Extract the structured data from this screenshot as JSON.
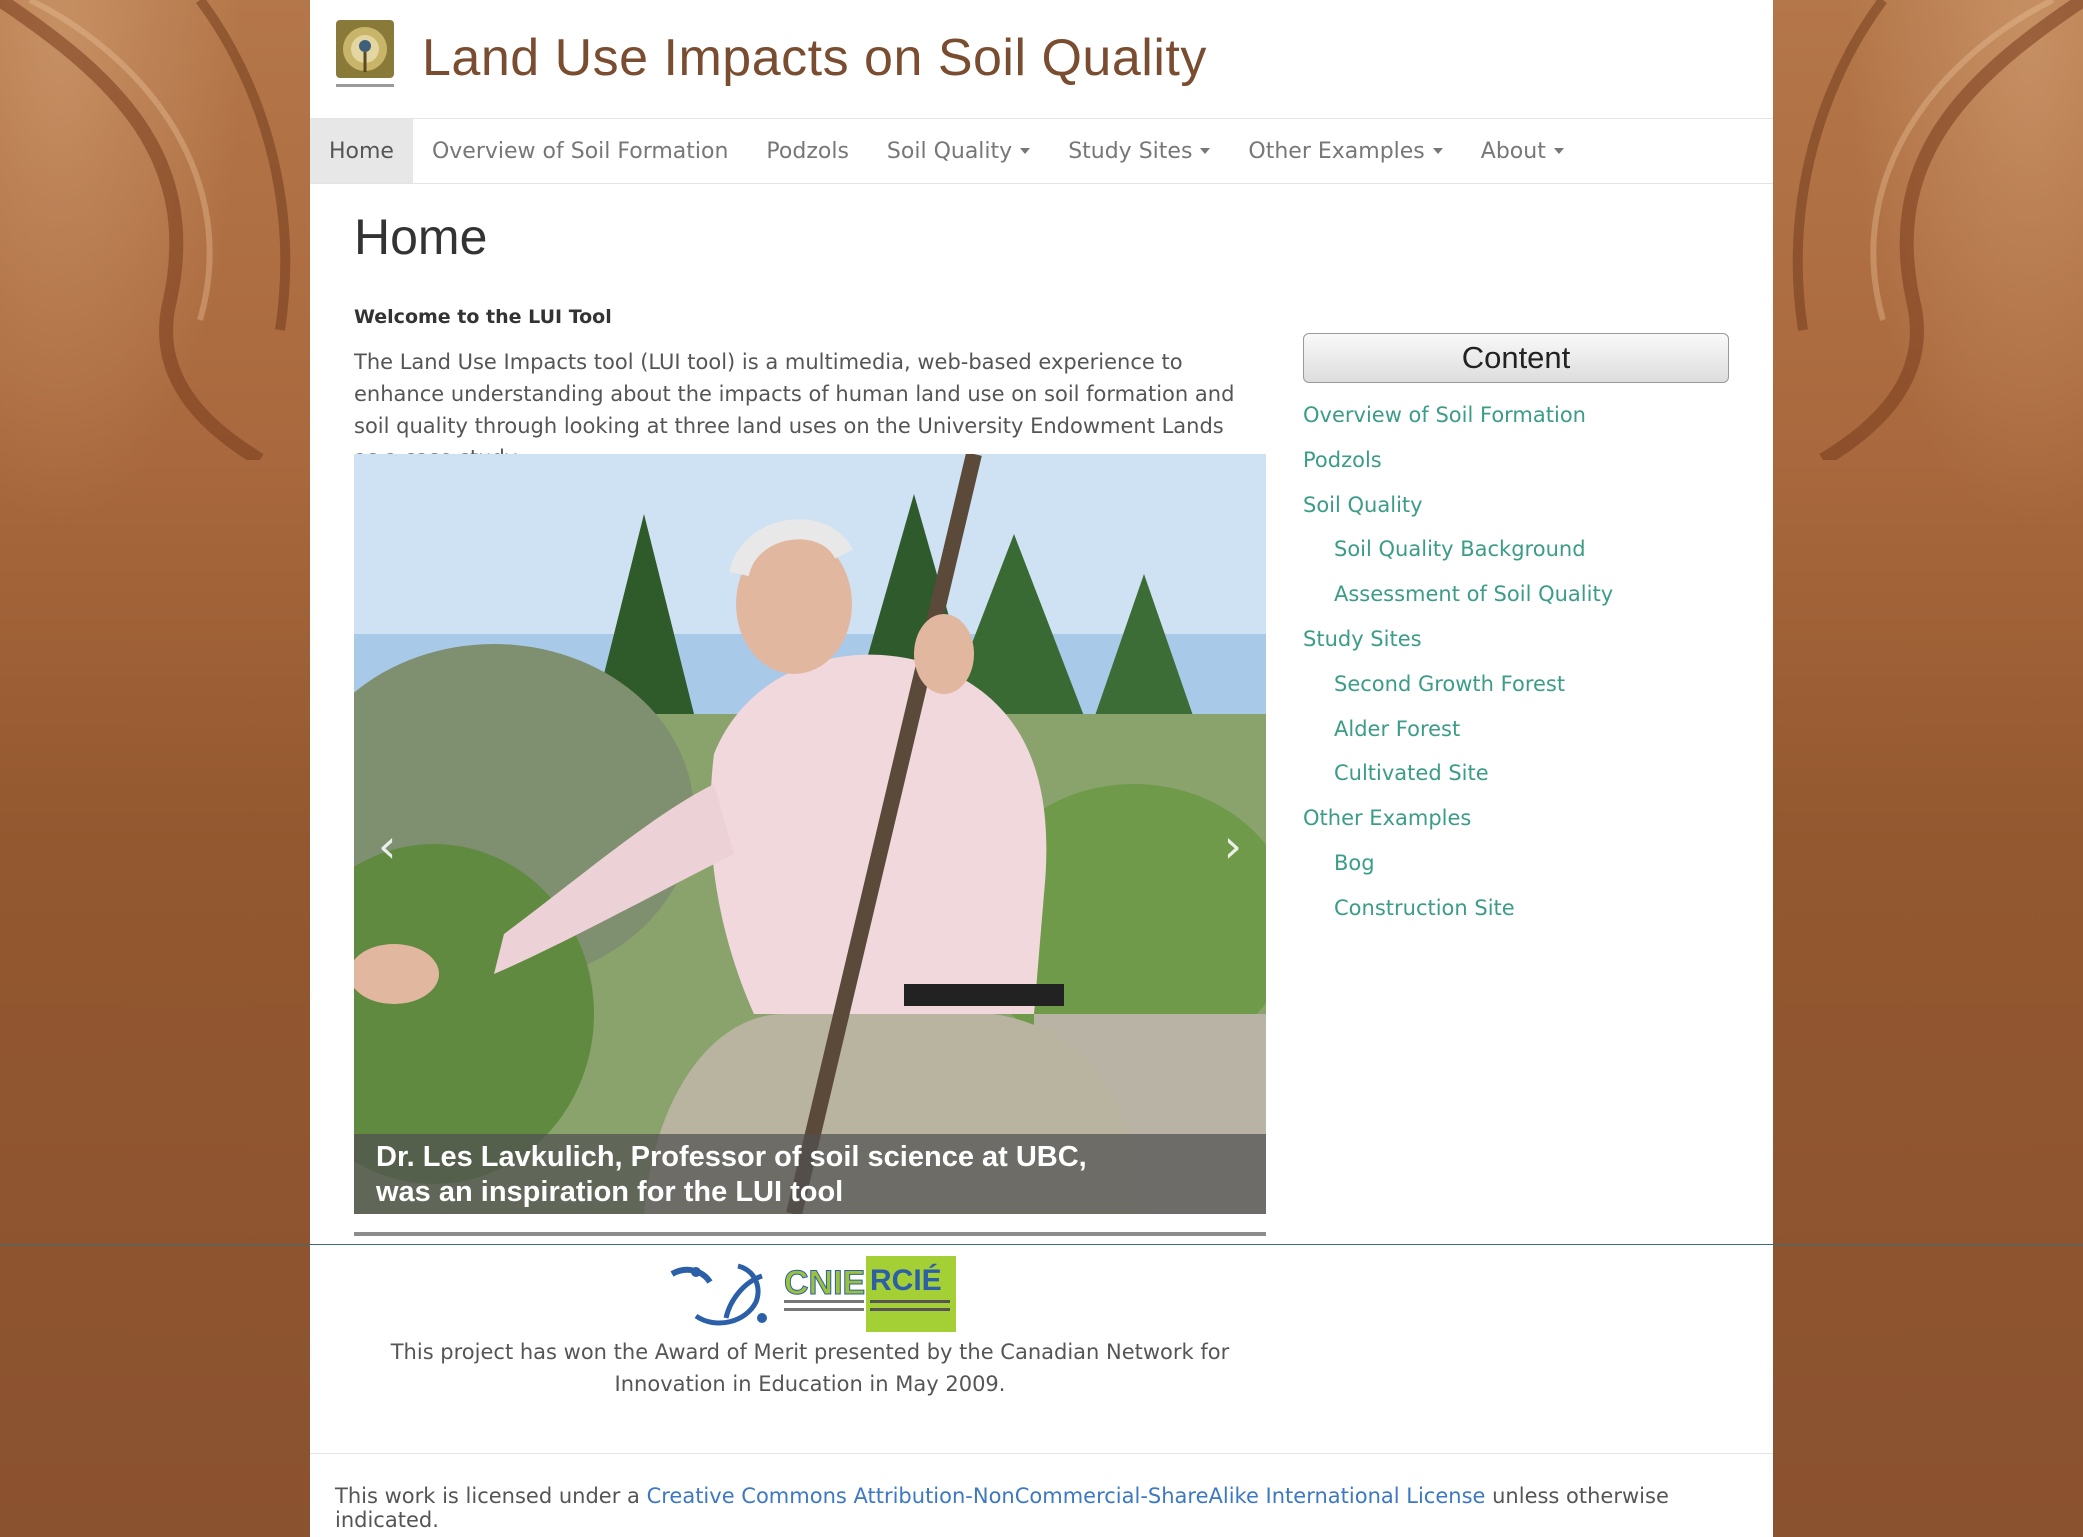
{
  "site": {
    "title": "Land Use Impacts on Soil Quality"
  },
  "nav": {
    "items": [
      {
        "label": "Home",
        "active": true,
        "dropdown": false
      },
      {
        "label": "Overview of Soil Formation",
        "dropdown": false
      },
      {
        "label": "Podzols",
        "dropdown": false
      },
      {
        "label": "Soil Quality",
        "dropdown": true
      },
      {
        "label": "Study Sites",
        "dropdown": true
      },
      {
        "label": "Other Examples",
        "dropdown": true
      },
      {
        "label": "About",
        "dropdown": true
      }
    ]
  },
  "main": {
    "title": "Home",
    "welcome": "Welcome to the LUI Tool",
    "intro": "The Land Use Impacts tool (LUI tool) is a multimedia, web-based experience to enhance understanding about the impacts of human land use on soil formation and soil quality through looking at three land uses on the University Endowment Lands as a case study.",
    "carousel": {
      "caption": "Dr. Les Lavkulich, Professor of soil science at UBC,\nwas an inspiration for the LUI tool",
      "prev_icon": "chevron-left-icon",
      "next_icon": "chevron-right-icon"
    }
  },
  "sidebar": {
    "heading": "Content",
    "items": [
      {
        "label": "Overview of Soil Formation",
        "level": 1
      },
      {
        "label": "Podzols",
        "level": 1
      },
      {
        "label": "Soil Quality",
        "level": 1
      },
      {
        "label": "Soil Quality Background",
        "level": 2
      },
      {
        "label": "Assessment of Soil Quality",
        "level": 2
      },
      {
        "label": "Study Sites",
        "level": 1
      },
      {
        "label": "Second Growth Forest",
        "level": 2
      },
      {
        "label": "Alder Forest",
        "level": 2
      },
      {
        "label": "Cultivated Site",
        "level": 2
      },
      {
        "label": "Other Examples",
        "level": 1
      },
      {
        "label": "Bog",
        "level": 2
      },
      {
        "label": "Construction Site",
        "level": 2
      }
    ]
  },
  "award": {
    "logo_text": "CNIE RCIÉ",
    "text": "This project has won the Award of Merit presented by the Canadian Network for Innovation in Education in May 2009."
  },
  "footer": {
    "prefix": "This work is licensed under a ",
    "link": "Creative Commons Attribution-NonCommercial-ShareAlike International License",
    "suffix": " unless otherwise indicated."
  },
  "colors": {
    "title": "#7a4d31",
    "sidebar_link": "#3b9c87",
    "footer_link": "#3c78c3",
    "background": "#a9683d"
  }
}
